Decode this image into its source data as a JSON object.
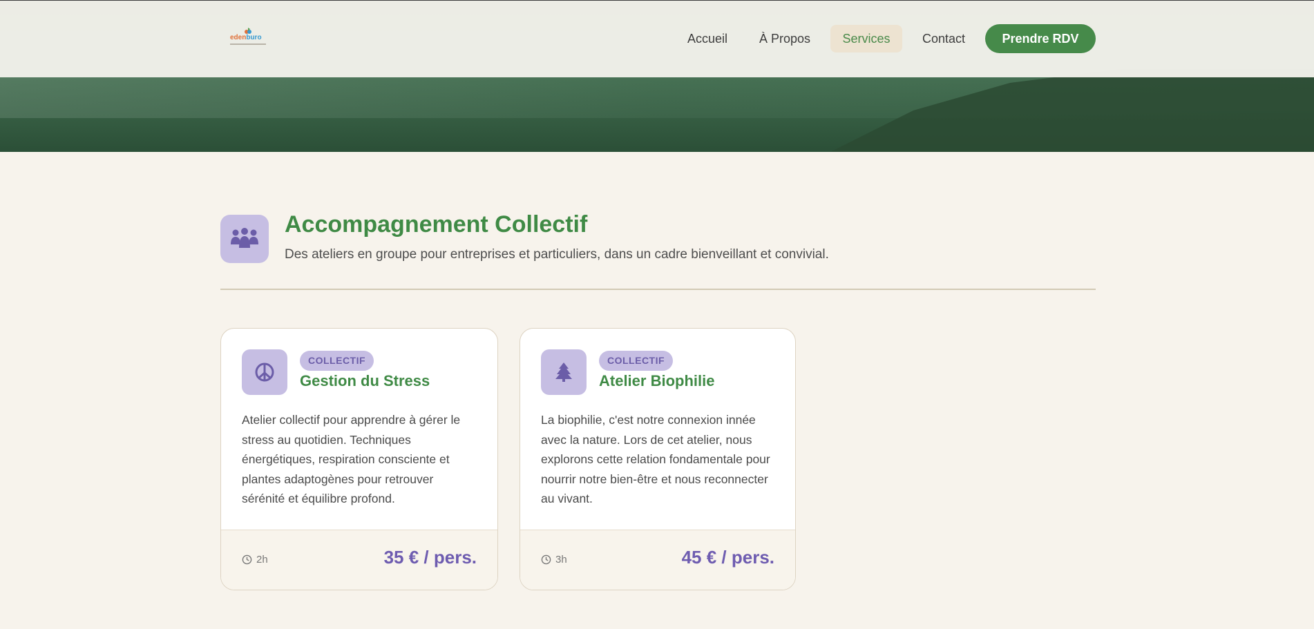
{
  "header": {
    "logo": {
      "eden": "eden",
      "buro": "buro"
    },
    "nav": [
      {
        "label": "Accueil"
      },
      {
        "label": "À Propos"
      },
      {
        "label": "Services"
      },
      {
        "label": "Contact"
      }
    ],
    "active_nav": "Services",
    "cta_label": "Prendre RDV"
  },
  "section": {
    "icon": "group-people-icon",
    "title": "Accompagnement Collectif",
    "subtitle": "Des ateliers en groupe pour entreprises et particuliers, dans un cadre bienveillant et convivial."
  },
  "cards": [
    {
      "icon": "peace-icon",
      "badge": "COLLECTIF",
      "title": "Gestion du Stress",
      "description": "Atelier collectif pour apprendre à gérer le stress au quotidien. Techniques énergétiques, respiration consciente et plantes adaptogènes pour retrouver sérénité et équilibre profond.",
      "duration": "2h",
      "price": "35 € / pers."
    },
    {
      "icon": "tree-icon",
      "badge": "COLLECTIF",
      "title": "Atelier Biophilie",
      "description": "La biophilie, c'est notre connexion innée avec la nature. Lors de cet atelier, nous explorons cette relation fondamentale pour nourrir notre bien-être et nous reconnecter au vivant.",
      "duration": "3h",
      "price": "45 € / pers."
    }
  ],
  "colors": {
    "brand_green": "#468a4a",
    "lavender": "#c6bee3",
    "price_purple": "#6e5cb0",
    "background": "#f7f3ec"
  }
}
